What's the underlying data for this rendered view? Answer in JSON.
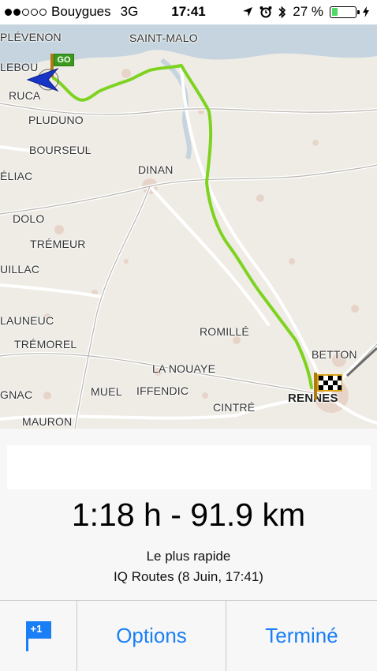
{
  "status_bar": {
    "carrier": "Bouygues",
    "network": "3G",
    "time": "17:41",
    "battery_percent": "27 %",
    "battery_level": 0.27,
    "icons": [
      "location-arrow-icon",
      "alarm-icon",
      "bluetooth-icon",
      "battery-icon",
      "charging-icon"
    ]
  },
  "map": {
    "places": {
      "plevenon": "PLÉVENON",
      "saint_malo": "SAINT-MALO",
      "lebou": "LEBOU",
      "ruca": "RUCA",
      "pluduno": "PLUDUNO",
      "bourseul": "BOURSEUL",
      "eliac": "ÉLIAC",
      "dinan": "DINAN",
      "dolo": "DOLO",
      "tremeur": "TRÉMEUR",
      "uillac": "UILLAC",
      "launeuc": "LAUNEUC",
      "tremorel": "TRÉMOREL",
      "romille": "ROMILLÉ",
      "betton": "BETTON",
      "la_nouaye": "LA NOUAYE",
      "gnac": "GNAC",
      "muel": "MUEL",
      "iffendic": "IFFENDIC",
      "rennes": "RENNES",
      "cintre": "CINTRÉ",
      "mauron": "MAURON"
    },
    "start_badge": "GO",
    "route_color": "#7ed321",
    "start_icon": "go-flag-icon",
    "end_icon": "checkered-flag-icon",
    "position_icon": "navigation-arrow-icon"
  },
  "panel": {
    "summary": "1:18 h - 91.9 km",
    "route_type": "Le plus rapide",
    "route_source": "IQ Routes (8 Juin, 17:41)"
  },
  "toolbar": {
    "flag_badge": "+1",
    "options_label": "Options",
    "done_label": "Terminé",
    "accent_color": "#1a7ff5"
  }
}
